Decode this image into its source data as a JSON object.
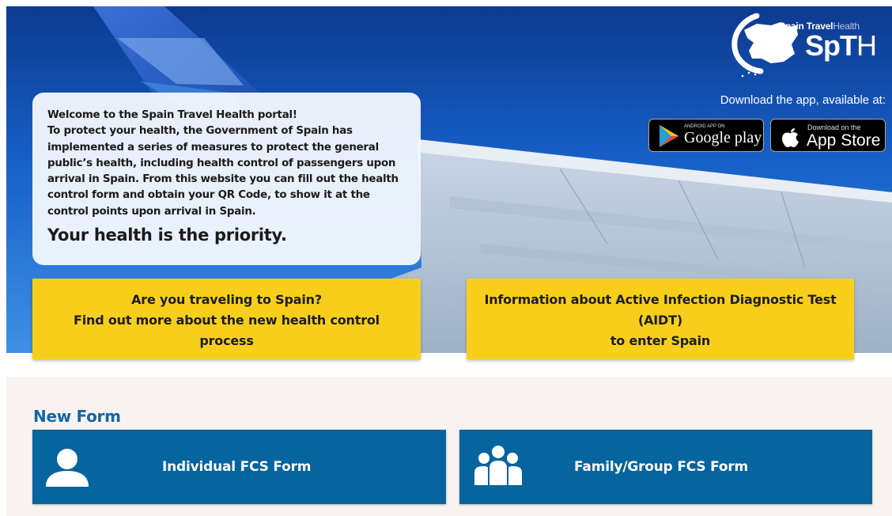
{
  "brand": {
    "name_part1": "Spain Travel",
    "name_part2": "Health",
    "acronym_bold": "SpT",
    "acronym_light": "H"
  },
  "apps": {
    "download_label": "Download the app, available at:",
    "google_small": "ANDROID APP ON",
    "google_big": "Google play",
    "apple_small": "Download on the",
    "apple_big": "App Store"
  },
  "welcome": {
    "text": "Welcome to the Spain Travel Health portal!\nTo protect your health, the Government of Spain has\nimplemented a series of measures to protect the general\npublic’s health, including health control of passengers upon\narrival in Spain. From this website you can fill out the health\ncontrol form and obtain your QR Code, to show it at the\ncontrol points upon arrival in Spain.",
    "tagline": "Your health is the priority."
  },
  "cta": {
    "traveling": "Are you traveling to Spain?\nFind out more about the new health control\nprocess",
    "aidt": "Information about Active Infection Diagnostic Test\n(AIDT)\nto enter Spain"
  },
  "new_form": {
    "title": "New Form",
    "individual_label": "Individual FCS Form",
    "group_label": "Family/Group FCS Form"
  },
  "colors": {
    "accent_yellow": "#f7cf1b",
    "primary_blue": "#06649e",
    "title_blue": "#1466a3",
    "section_bg": "#f8f3f1"
  },
  "icons": {
    "logo": "spain-map-globe-icon",
    "google_play": "play-triangle-icon",
    "apple": "apple-icon",
    "individual": "person-icon",
    "group": "people-group-icon"
  }
}
